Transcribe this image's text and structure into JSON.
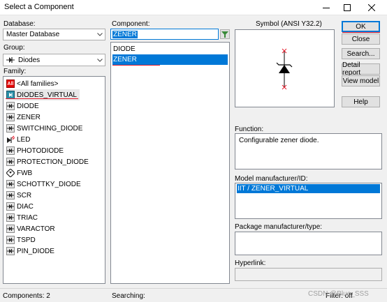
{
  "window": {
    "title": "Select a Component",
    "controls": {
      "minimize": "minimize-icon",
      "maximize": "maximize-icon",
      "close": "close-icon"
    }
  },
  "database": {
    "label": "Database:",
    "value": "Master Database"
  },
  "group": {
    "label": "Group:",
    "value": "Diodes"
  },
  "family": {
    "label": "Family:",
    "items": [
      {
        "label": "<All families>",
        "icon": "all-icon"
      },
      {
        "label": "DIODES_VIRTUAL",
        "icon": "virtual-diode-icon"
      },
      {
        "label": "DIODE",
        "icon": "diode-icon"
      },
      {
        "label": "ZENER",
        "icon": "zener-icon"
      },
      {
        "label": "SWITCHING_DIODE",
        "icon": "switching-diode-icon"
      },
      {
        "label": "LED",
        "icon": "led-icon"
      },
      {
        "label": "PHOTODIODE",
        "icon": "photodiode-icon"
      },
      {
        "label": "PROTECTION_DIODE",
        "icon": "protection-diode-icon"
      },
      {
        "label": "FWB",
        "icon": "bridge-rectifier-icon"
      },
      {
        "label": "SCHOTTKY_DIODE",
        "icon": "schottky-diode-icon"
      },
      {
        "label": "SCR",
        "icon": "scr-icon"
      },
      {
        "label": "DIAC",
        "icon": "diac-icon"
      },
      {
        "label": "TRIAC",
        "icon": "triac-icon"
      },
      {
        "label": "VARACTOR",
        "icon": "varactor-icon"
      },
      {
        "label": "TSPD",
        "icon": "tspd-icon"
      },
      {
        "label": "PIN_DIODE",
        "icon": "pin-diode-icon"
      }
    ],
    "selected": "DIODES_VIRTUAL"
  },
  "component": {
    "label": "Component:",
    "input_value": "ZENER",
    "items": [
      "DIODE",
      "ZENER"
    ],
    "selected": "ZENER"
  },
  "symbol": {
    "label": "Symbol (ANSI Y32.2)"
  },
  "buttons": {
    "ok": "OK",
    "close": "Close",
    "search": "Search...",
    "detail_report": "Detail report",
    "view_model": "View model",
    "help": "Help"
  },
  "function": {
    "label": "Function:",
    "text": "Configurable zener diode."
  },
  "model": {
    "label": "Model manufacturer/ID:",
    "items": [
      "IIT / ZENER_VIRTUAL"
    ]
  },
  "package": {
    "label": "Package manufacturer/type:"
  },
  "hyperlink": {
    "label": "Hyperlink:"
  },
  "status": {
    "components": "Components: 2",
    "searching": "Searching:",
    "filter": "Filter: off",
    "watermark": "CSDN @Blue_SSS"
  },
  "colors": {
    "selection": "#0078d7",
    "annotation": "#e41b2b",
    "all_badge": "#e60000"
  }
}
